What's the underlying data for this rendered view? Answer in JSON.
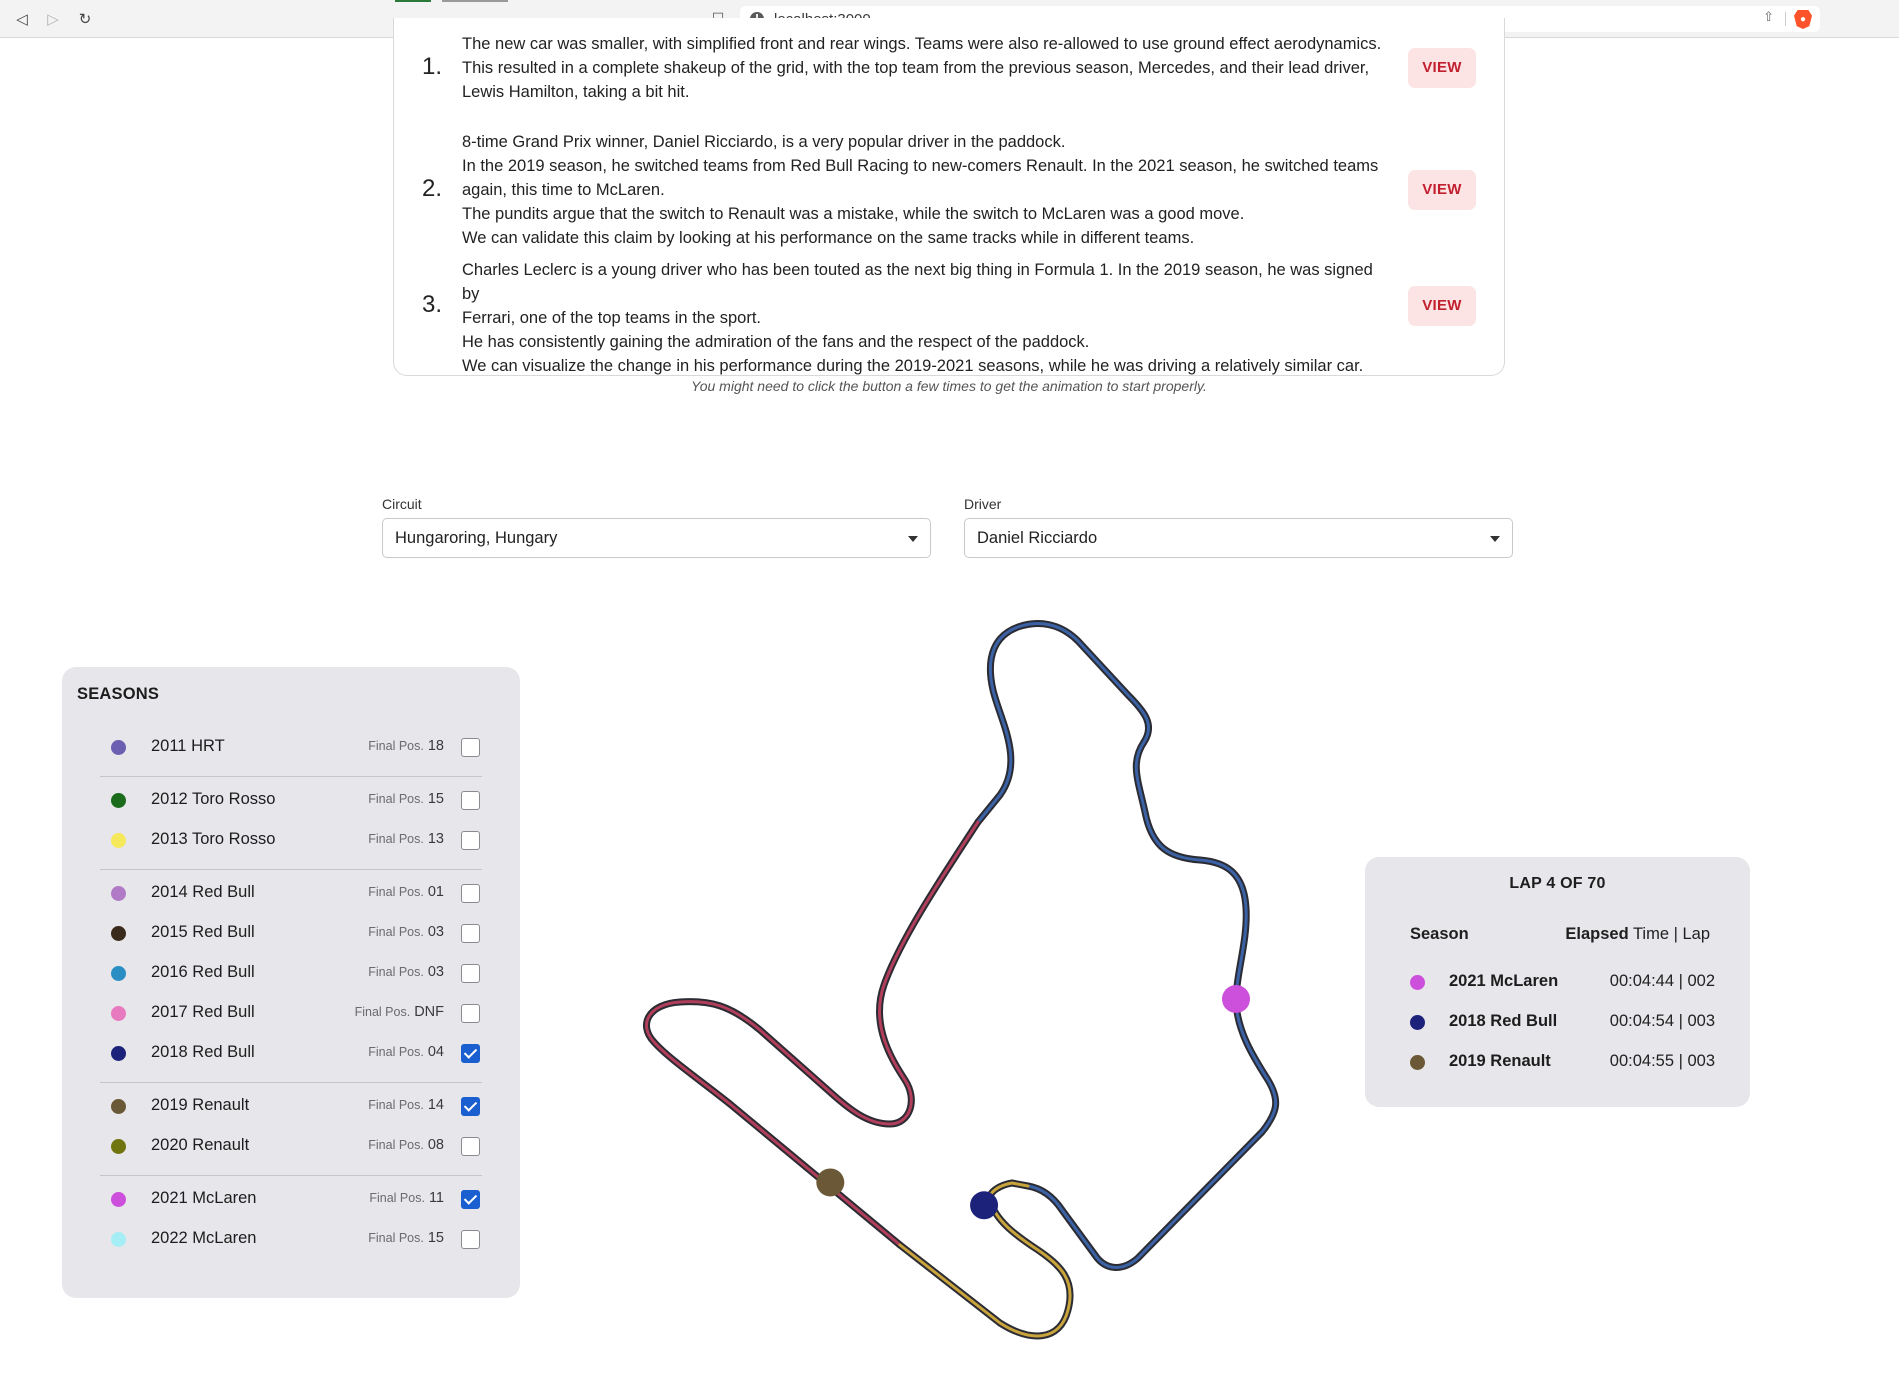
{
  "browser": {
    "url": "localhost:3000"
  },
  "stories": [
    {
      "number": "1.",
      "lines": [
        "The new car was smaller, with simplified front and rear wings. Teams were also re-allowed to use ground effect aerodynamics.",
        "This resulted in a complete shakeup of the grid, with the top team from the previous season, Mercedes, and their lead driver,",
        "Lewis Hamilton, taking a bit hit."
      ],
      "button": "VIEW"
    },
    {
      "number": "2.",
      "lines": [
        "8-time Grand Prix winner, Daniel Ricciardo, is a very popular driver in the paddock.",
        "In the 2019 season, he switched teams from Red Bull Racing to new-comers Renault. In the 2021 season, he switched teams",
        "again, this time to McLaren.",
        "The pundits argue that the switch to Renault was a mistake, while the switch to McLaren was a good move.",
        "We can validate this claim by looking at his performance on the same tracks while in different teams."
      ],
      "button": "VIEW"
    },
    {
      "number": "3.",
      "lines": [
        "Charles Leclerc is a young driver who has been touted as the next big thing in Formula 1. In the 2019 season, he was signed by",
        "Ferrari, one of the top teams in the sport.",
        "He has consistently gaining the admiration of the fans and the respect of the paddock.",
        "We can visualize the change in his performance during the 2019-2021 seasons, while he was driving a relatively similar car."
      ],
      "button": "VIEW"
    }
  ],
  "note": "You might need to click the button a few times to get the animation to start properly.",
  "filters": {
    "circuit": {
      "label": "Circuit",
      "value": "Hungaroring, Hungary"
    },
    "driver": {
      "label": "Driver",
      "value": "Daniel Ricciardo"
    }
  },
  "seasons": {
    "title": "SEASONS",
    "final_pos_label": "Final Pos.",
    "items": [
      {
        "label": "2011 HRT",
        "pos": "18",
        "color": "#6a5fb0",
        "checked": false
      },
      {
        "label": "2012 Toro Rosso",
        "pos": "15",
        "color": "#1a6b1a",
        "checked": false
      },
      {
        "label": "2013 Toro Rosso",
        "pos": "13",
        "color": "#f5e85a",
        "checked": false
      },
      {
        "label": "2014 Red Bull",
        "pos": "01",
        "color": "#b07ac6",
        "checked": false
      },
      {
        "label": "2015 Red Bull",
        "pos": "03",
        "color": "#3a2a1c",
        "checked": false
      },
      {
        "label": "2016 Red Bull",
        "pos": "03",
        "color": "#2a8ec4",
        "checked": false
      },
      {
        "label": "2017 Red Bull",
        "pos": "DNF",
        "color": "#e87abf",
        "checked": false
      },
      {
        "label": "2018 Red Bull",
        "pos": "04",
        "color": "#1c227a",
        "checked": true
      },
      {
        "label": "2019 Renault",
        "pos": "14",
        "color": "#6b5836",
        "checked": true
      },
      {
        "label": "2020 Renault",
        "pos": "08",
        "color": "#717510",
        "checked": false
      },
      {
        "label": "2021 McLaren",
        "pos": "11",
        "color": "#cc50dc",
        "checked": true
      },
      {
        "label": "2022 McLaren",
        "pos": "15",
        "color": "#a6eef5",
        "checked": false
      }
    ]
  },
  "track": {
    "sector_colors": [
      "#3a62a4",
      "#b13f5c",
      "#c9a43c"
    ],
    "markers": [
      {
        "season": "2021 McLaren",
        "color": "#cc50dc"
      },
      {
        "season": "2018 Red Bull",
        "color": "#1c227a"
      },
      {
        "season": "2019 Renault",
        "color": "#6b5836"
      }
    ]
  },
  "lap_panel": {
    "title": "LAP 4 OF 70",
    "header_season": "Season",
    "header_elapsed": "Elapsed",
    "header_rest": "Time | Lap",
    "rows": [
      {
        "season": "2021 McLaren",
        "time": "00:04:44 | 002",
        "color": "#cc50dc"
      },
      {
        "season": "2018 Red Bull",
        "time": "00:04:54 | 003",
        "color": "#1c227a"
      },
      {
        "season": "2019 Renault",
        "time": "00:04:55 | 003",
        "color": "#6b5836"
      }
    ]
  }
}
